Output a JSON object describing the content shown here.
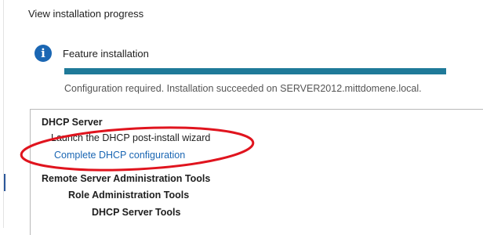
{
  "page": {
    "heading": "View installation progress"
  },
  "feature": {
    "icon": "info-icon",
    "icon_glyph": "i",
    "title": "Feature installation",
    "progress_percent": 100,
    "progress_color": "#1f7a99",
    "status": "Configuration required. Installation succeeded on SERVER2012.mittdomene.local."
  },
  "results": {
    "dhcp_server_label": "DHCP Server",
    "launch_wizard_label": "Launch the DHCP post-install wizard",
    "complete_config_link": "Complete DHCP configuration",
    "rsat_label": "Remote Server Administration Tools",
    "role_admin_label": "Role Administration Tools",
    "dhcp_tools_label": "DHCP Server Tools"
  },
  "annotation": {
    "color": "#e0141e"
  }
}
